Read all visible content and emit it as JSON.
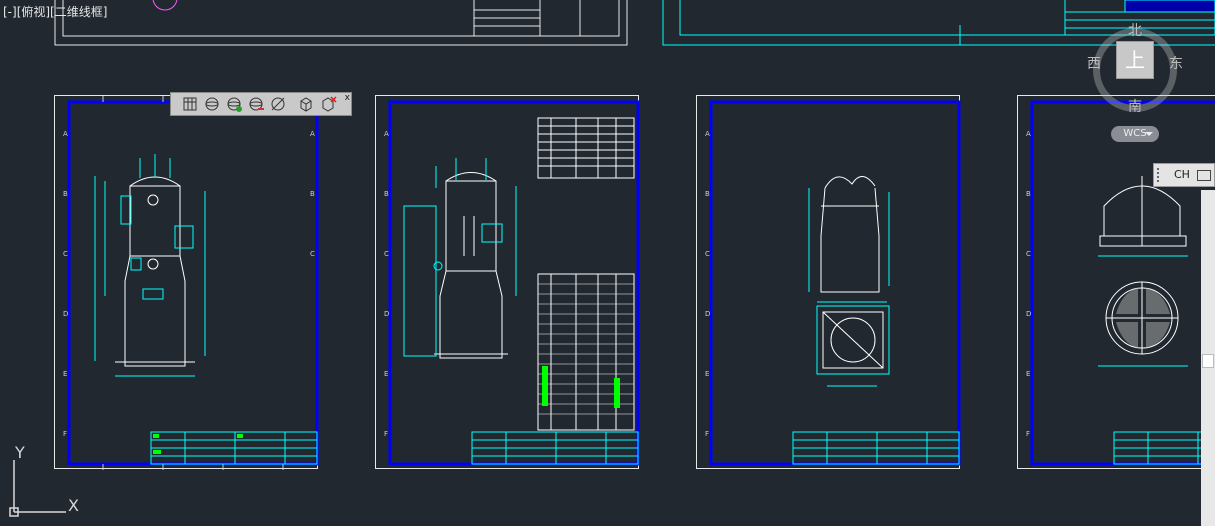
{
  "viewport": {
    "label": "[-][俯视][二维线框]"
  },
  "toolbar": {
    "buttons": [
      "view-box-icon",
      "sphere-view-icon",
      "sphere-add-icon",
      "sphere-remove-icon",
      "clip-circle-icon",
      "cube-icon",
      "cube-delete-icon"
    ],
    "close_label": "x"
  },
  "viewcube": {
    "north": "北",
    "south": "南",
    "east": "东",
    "west": "西",
    "face": "上",
    "coord_system": "WCS"
  },
  "command_line": {
    "language": "CH"
  },
  "ucs": {
    "x_label": "X",
    "y_label": "Y"
  },
  "sheets": [
    {
      "id": "sheet-1"
    },
    {
      "id": "sheet-2"
    },
    {
      "id": "sheet-3"
    },
    {
      "id": "sheet-4"
    }
  ],
  "colors": {
    "background": "#212830",
    "sheet_border": "#e8e8e8",
    "frame_blue": "#0000ff",
    "drawing_cyan": "#00ffff",
    "drawing_white": "#ffffff",
    "text_green": "#00ff00"
  }
}
